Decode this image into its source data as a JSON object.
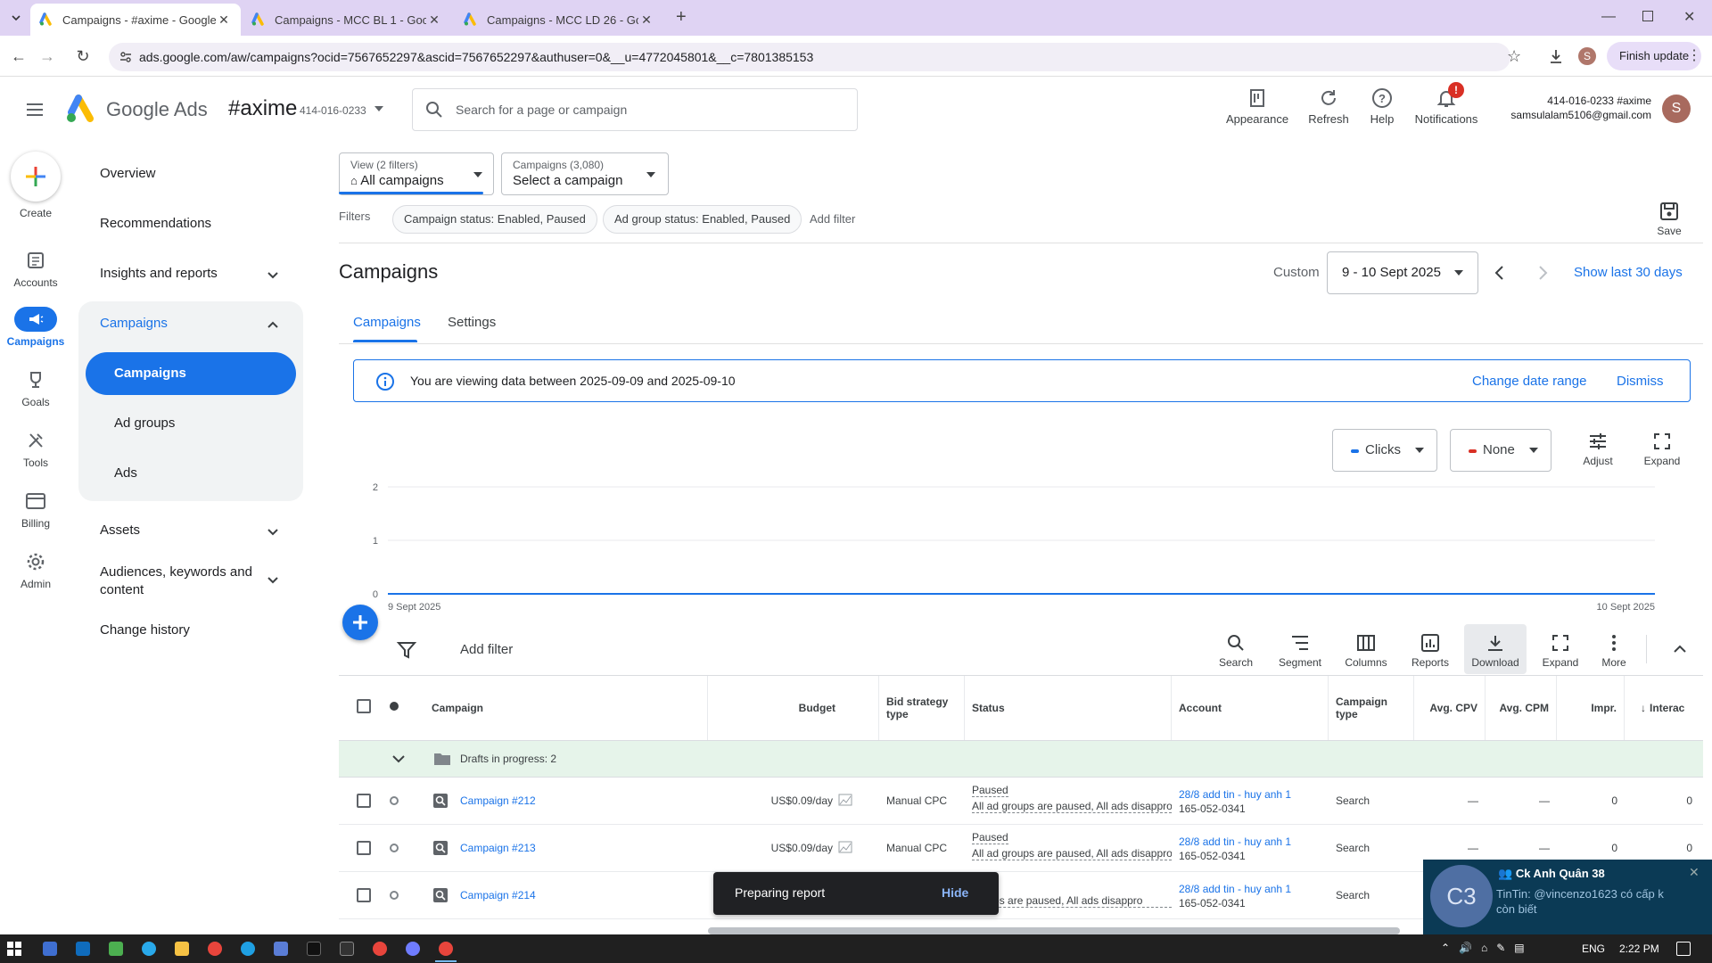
{
  "browser": {
    "tabs": [
      {
        "title": "Campaigns - #axime - Google A",
        "active": true
      },
      {
        "title": "Campaigns - MCC BL 1 - Googl",
        "active": false
      },
      {
        "title": "Campaigns - MCC LD 26 - Goo",
        "active": false
      }
    ],
    "url": "ads.google.com/aw/campaigns?ocid=7567652297&ascid=7567652297&authuser=0&__u=4772045801&__c=7801385153",
    "profile_initial": "S",
    "finish_update": "Finish update"
  },
  "header": {
    "product": "Google Ads",
    "account_name": "#axime",
    "account_id": "414-016-0233",
    "search_placeholder": "Search for a page or campaign",
    "appearance": "Appearance",
    "refresh": "Refresh",
    "help": "Help",
    "notifications": "Notifications",
    "notif_badge": "!",
    "user_account": "414-016-0233 #axime",
    "user_email": "samsulalam5106@gmail.com",
    "avatar": "S"
  },
  "rail": {
    "create": "Create",
    "accounts": "Accounts",
    "campaigns": "Campaigns",
    "goals": "Goals",
    "tools": "Tools",
    "billing": "Billing",
    "admin": "Admin"
  },
  "nav": {
    "overview": "Overview",
    "recommendations": "Recommendations",
    "insights": "Insights and reports",
    "campaigns": "Campaigns",
    "sub_campaigns": "Campaigns",
    "ad_groups": "Ad groups",
    "ads": "Ads",
    "assets": "Assets",
    "audiences_1": "Audiences, keywords and",
    "audiences_2": "content",
    "change_history": "Change history"
  },
  "main": {
    "view_label": "View (2 filters)",
    "view_value": "All campaigns",
    "campaigns_label": "Campaigns (3,080)",
    "campaigns_value": "Select a campaign",
    "filters_label": "Filters",
    "filter_chips": [
      "Campaign status: Enabled, Paused",
      "Ad group status: Enabled, Paused"
    ],
    "add_filter": "Add filter",
    "save": "Save",
    "page_title": "Campaigns",
    "date_custom": "Custom",
    "date_range": "9 - 10 Sept 2025",
    "show_last": "Show last 30 days",
    "tabs": [
      "Campaigns",
      "Settings"
    ],
    "info_text": "You are viewing data between 2025-09-09 and 2025-09-10",
    "change_date": "Change date range",
    "dismiss": "Dismiss",
    "metric1": "Clicks",
    "metric2": "None",
    "adjust": "Adjust",
    "expand": "Expand",
    "metric1_color": "#1a73e8",
    "metric2_color": "#d93025"
  },
  "chart_data": {
    "type": "line",
    "x": [
      "9 Sept 2025",
      "10 Sept 2025"
    ],
    "series": [
      {
        "name": "Clicks",
        "values": [
          0,
          0
        ]
      }
    ],
    "y_ticks": [
      0,
      1,
      2
    ],
    "ylim": [
      0,
      2
    ]
  },
  "toolbar": {
    "add_filter": "Add filter",
    "search": "Search",
    "segment": "Segment",
    "columns": "Columns",
    "reports": "Reports",
    "download": "Download",
    "expand": "Expand",
    "more": "More"
  },
  "table": {
    "headers": {
      "campaign": "Campaign",
      "budget": "Budget",
      "bid1": "Bid strategy",
      "bid2": "type",
      "status": "Status",
      "account": "Account",
      "ctype1": "Campaign",
      "ctype2": "type",
      "cpv": "Avg. CPV",
      "cpm": "Avg. CPM",
      "impr": "Impr.",
      "interactions": "Interac"
    },
    "drafts": "Drafts in progress: 2",
    "rows": [
      {
        "name": "Campaign #212",
        "budget": "US$0.09/day",
        "bid": "Manual CPC",
        "status": "Paused",
        "status_detail": "All ad groups are paused, All ads disappro",
        "account": "28/8 add tin - huy anh 1",
        "account_id": "165-052-0341",
        "type": "Search",
        "cpv": "—",
        "cpm": "—",
        "impr": "0",
        "inter": "0"
      },
      {
        "name": "Campaign #213",
        "budget": "US$0.09/day",
        "bid": "Manual CPC",
        "status": "Paused",
        "status_detail": "All ad groups are paused, All ads disappro",
        "account": "28/8 add tin - huy anh 1",
        "account_id": "165-052-0341",
        "type": "Search",
        "cpv": "—",
        "cpm": "—",
        "impr": "0",
        "inter": "0"
      },
      {
        "name": "Campaign #214",
        "budget": "",
        "bid": "",
        "status": "d",
        "status_detail": "groups are paused, All ads disappro",
        "account": "28/8 add tin - huy anh 1",
        "account_id": "165-052-0341",
        "type": "Search",
        "cpv": "",
        "cpm": "",
        "impr": "",
        "inter": ""
      }
    ]
  },
  "snackbar": {
    "text": "Preparing report",
    "hide": "Hide"
  },
  "chat_popup": {
    "avatar": "C3",
    "title": "Ck Anh Quân 38",
    "sender": "TinTin:",
    "message": "@vincenzo1623 có cấp k",
    "message2": "còn biết"
  },
  "taskbar": {
    "lang": "ENG",
    "time": "2:22 PM"
  }
}
